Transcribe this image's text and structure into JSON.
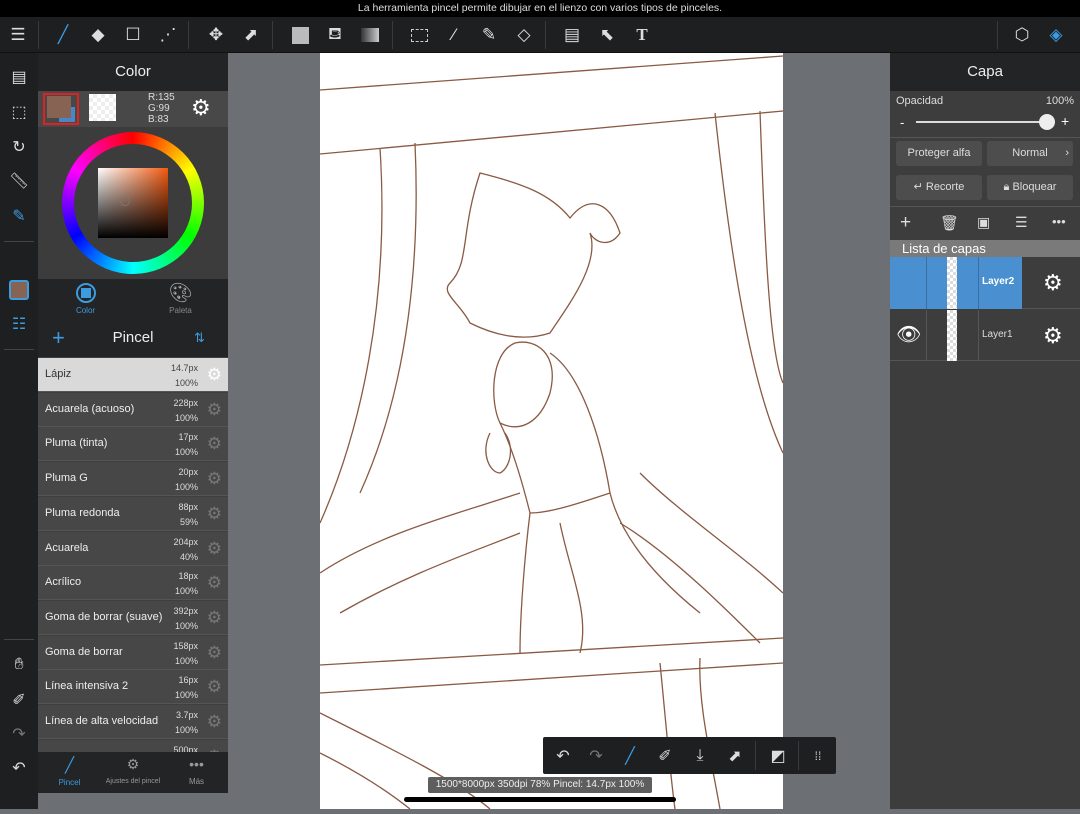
{
  "status_message": "La herramienta pincel permite dibujar en el lienzo con varios tipos de pinceles.",
  "toolbar": {
    "icons": [
      "menu-icon",
      "brush-icon",
      "eraser-icon",
      "rectangle-icon",
      "correction-icon",
      "move-icon",
      "transform-icon",
      "fill-color-icon",
      "bucket-icon",
      "gradient-icon",
      "select-rect-icon",
      "magic-wand-icon",
      "select-pen-icon",
      "select-eraser-icon",
      "frame-icon",
      "select-layer-icon",
      "text-icon",
      "materials-icon",
      "layers-icon"
    ],
    "text_glyph": "T"
  },
  "color_panel": {
    "title": "Color",
    "rgb": {
      "r": "R:135",
      "g": "G:99",
      "b": "B:83"
    },
    "foreground": "#876353",
    "tabs": [
      {
        "label": "Color"
      },
      {
        "label": "Paleta"
      }
    ]
  },
  "brush_panel": {
    "title": "Pincel",
    "brushes": [
      {
        "name": "Lápiz",
        "size": "14.7px",
        "opacity": "100%",
        "selected": true
      },
      {
        "name": "Acuarela (acuoso)",
        "size": "228px",
        "opacity": "100%"
      },
      {
        "name": "Pluma (tinta)",
        "size": "17px",
        "opacity": "100%"
      },
      {
        "name": "Pluma G",
        "size": "20px",
        "opacity": "100%"
      },
      {
        "name": "Pluma redonda",
        "size": "88px",
        "opacity": "59%"
      },
      {
        "name": "Acuarela",
        "size": "204px",
        "opacity": "40%"
      },
      {
        "name": "Acrílico",
        "size": "18px",
        "opacity": "100%"
      },
      {
        "name": "Goma de borrar (suave)",
        "size": "392px",
        "opacity": "100%"
      },
      {
        "name": "Goma de borrar",
        "size": "158px",
        "opacity": "100%"
      },
      {
        "name": "Línea intensiva 2",
        "size": "16px",
        "opacity": "100%"
      },
      {
        "name": "Línea de alta velocidad",
        "size": "3.7px",
        "opacity": "100%"
      },
      {
        "name": "",
        "size": "500px",
        "opacity": ""
      }
    ],
    "tabs": [
      {
        "label": "Pincel"
      },
      {
        "label": "Ajustes del pincel"
      },
      {
        "label": "Más"
      }
    ]
  },
  "layer_panel": {
    "title": "Capa",
    "opacity_label": "Opacidad",
    "opacity_value": "100%",
    "opacity_fraction": 1.0,
    "minus": "-",
    "plus": "+",
    "protect_alpha": "Proteger alfa",
    "blend_mode": "Normal",
    "clipping": "Recorte",
    "lock": "Bloquear",
    "list_title": "Lista de capas",
    "layers": [
      {
        "name": "Layer2",
        "selected": true,
        "visible": false
      },
      {
        "name": "Layer1",
        "selected": false,
        "visible": true
      }
    ]
  },
  "canvas_info": "1500*8000px 350dpi 78% Pincel: 14.7px 100%",
  "colors": {
    "accent": "#3d9be0",
    "stroke": "#8a5a44",
    "selected_layer": "#4a90d0"
  }
}
